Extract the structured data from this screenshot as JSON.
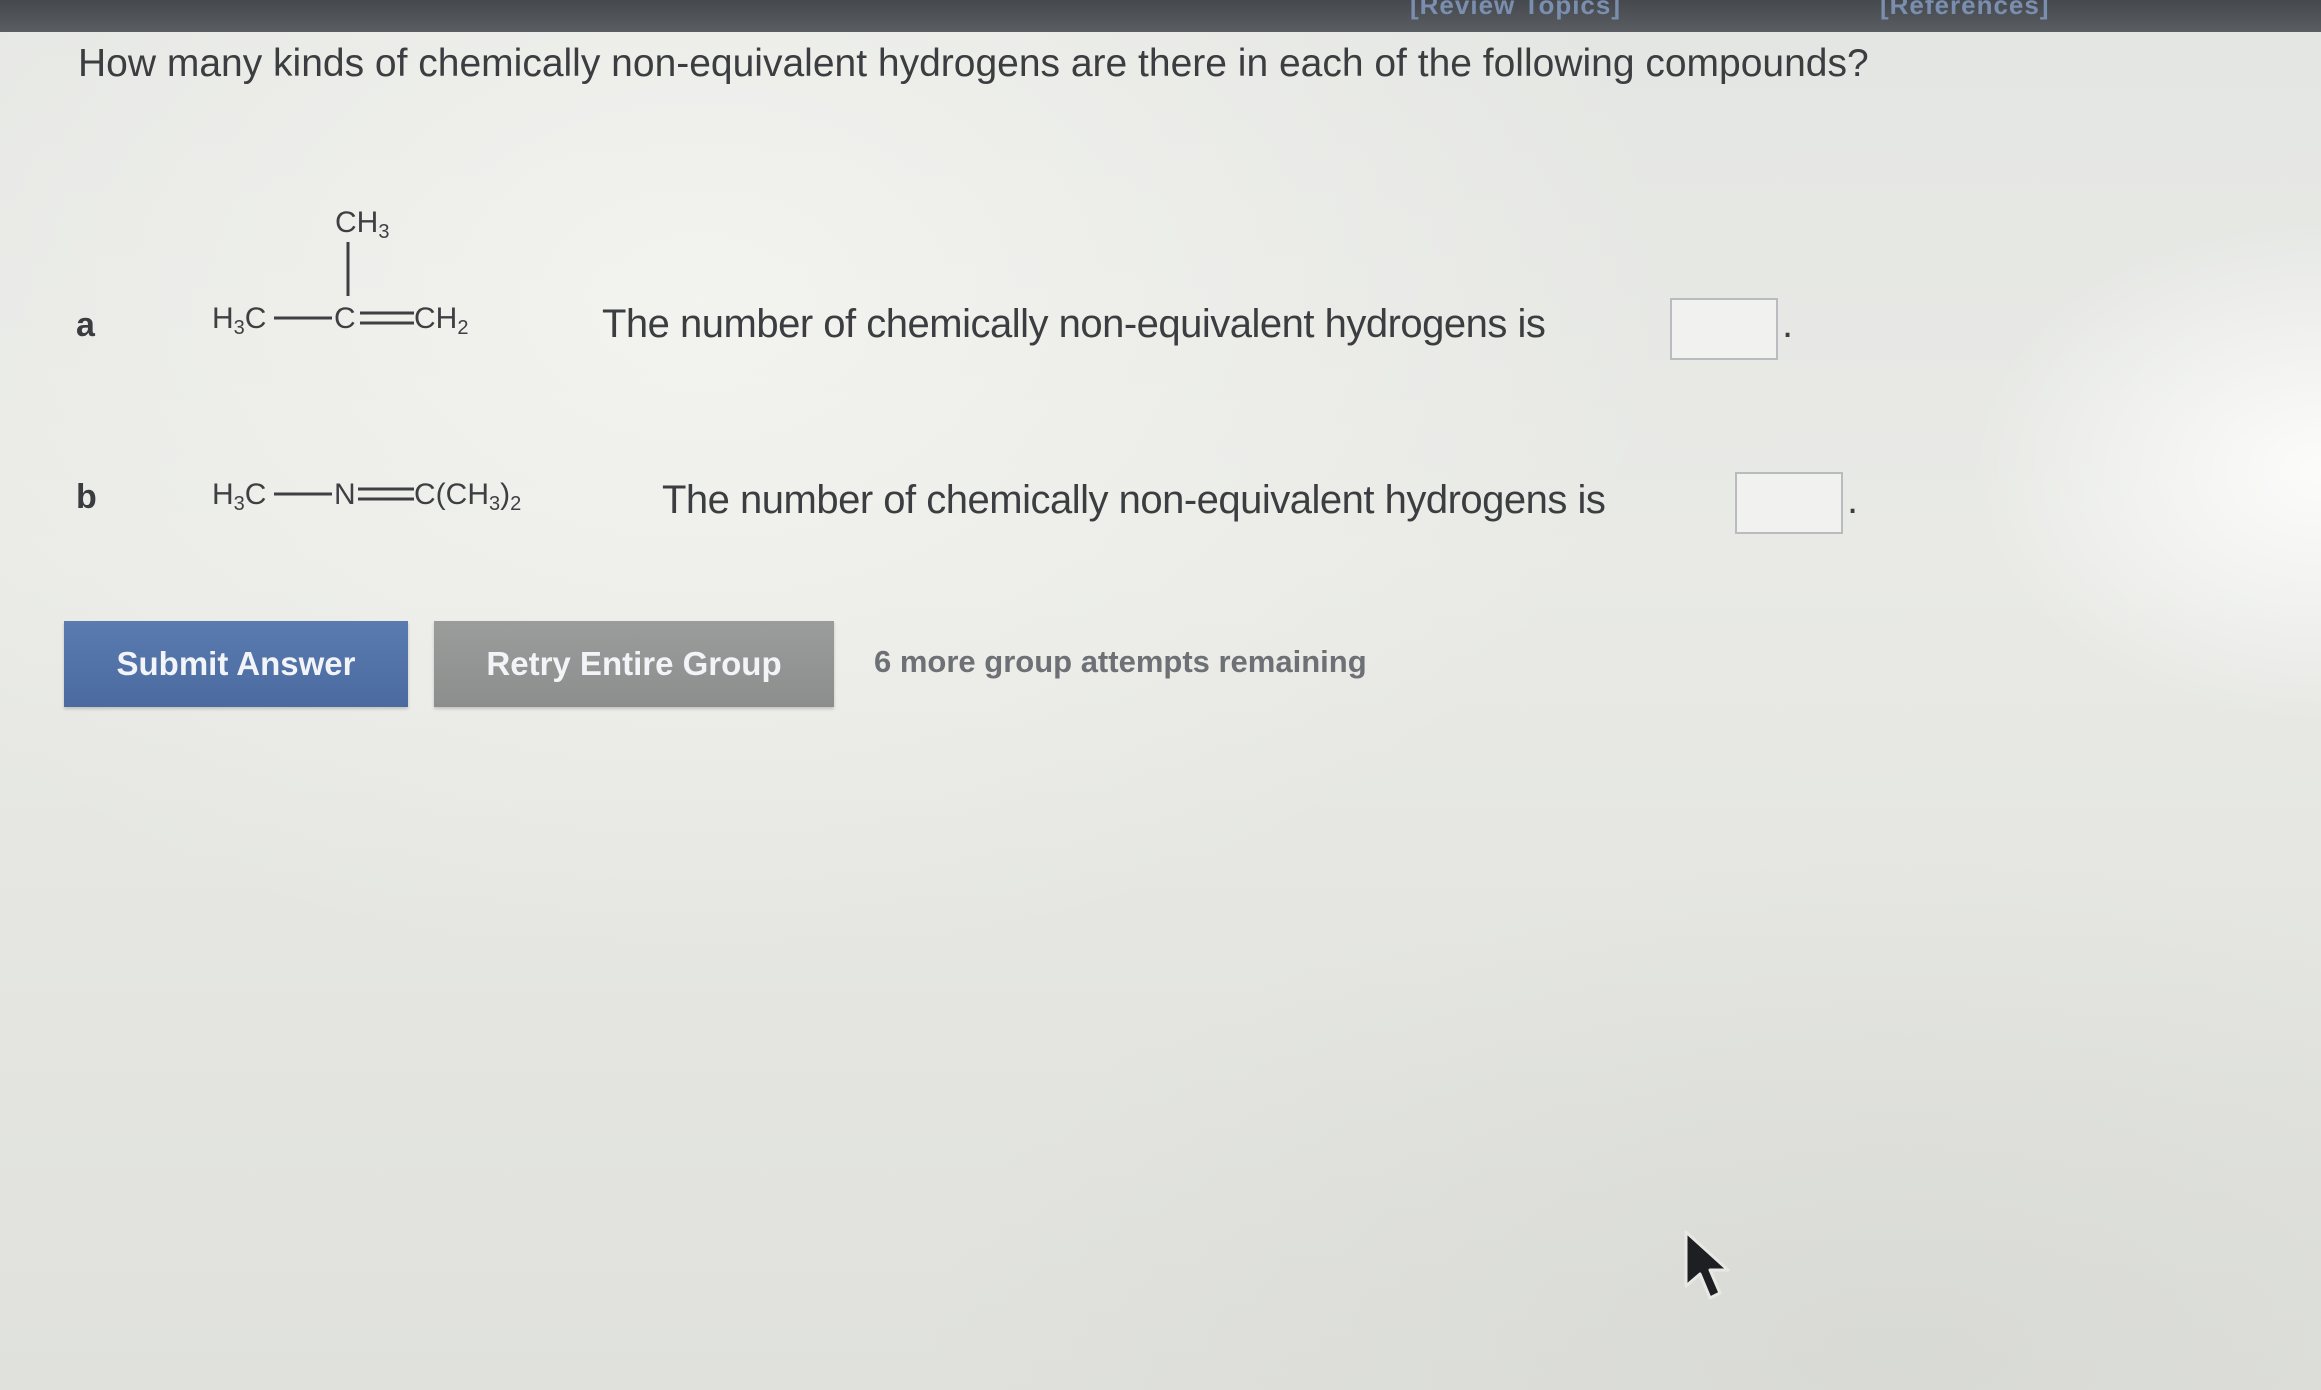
{
  "header": {
    "review_topics": "[Review Topics]",
    "references": "[References]"
  },
  "question": {
    "text": "How many kinds of chemically non-equivalent hydrogens are there in each of the following compounds?"
  },
  "parts": [
    {
      "letter": "a",
      "structure": {
        "top_group": "CH3",
        "left_group": "H3C",
        "center_atom": "C",
        "right_group": "CH2"
      },
      "prompt": "The number of chemically non-equivalent hydrogens is",
      "answer_value": "",
      "period": "."
    },
    {
      "letter": "b",
      "structure": {
        "left_group": "H3C",
        "middle_atom": "N",
        "right_group": "C(CH3)2"
      },
      "prompt": "The number of chemically non-equivalent hydrogens is",
      "answer_value": "",
      "period": "."
    }
  ],
  "actions": {
    "submit_label": "Submit Answer",
    "retry_label": "Retry Entire Group",
    "attempts_text": "6 more group attempts remaining"
  },
  "colors": {
    "submit_button": "#4f70a6",
    "retry_button": "#939594",
    "text": "#3b3d40",
    "top_bar": "#4c4f53"
  },
  "icons": {
    "cursor": "mouse-pointer-icon"
  }
}
